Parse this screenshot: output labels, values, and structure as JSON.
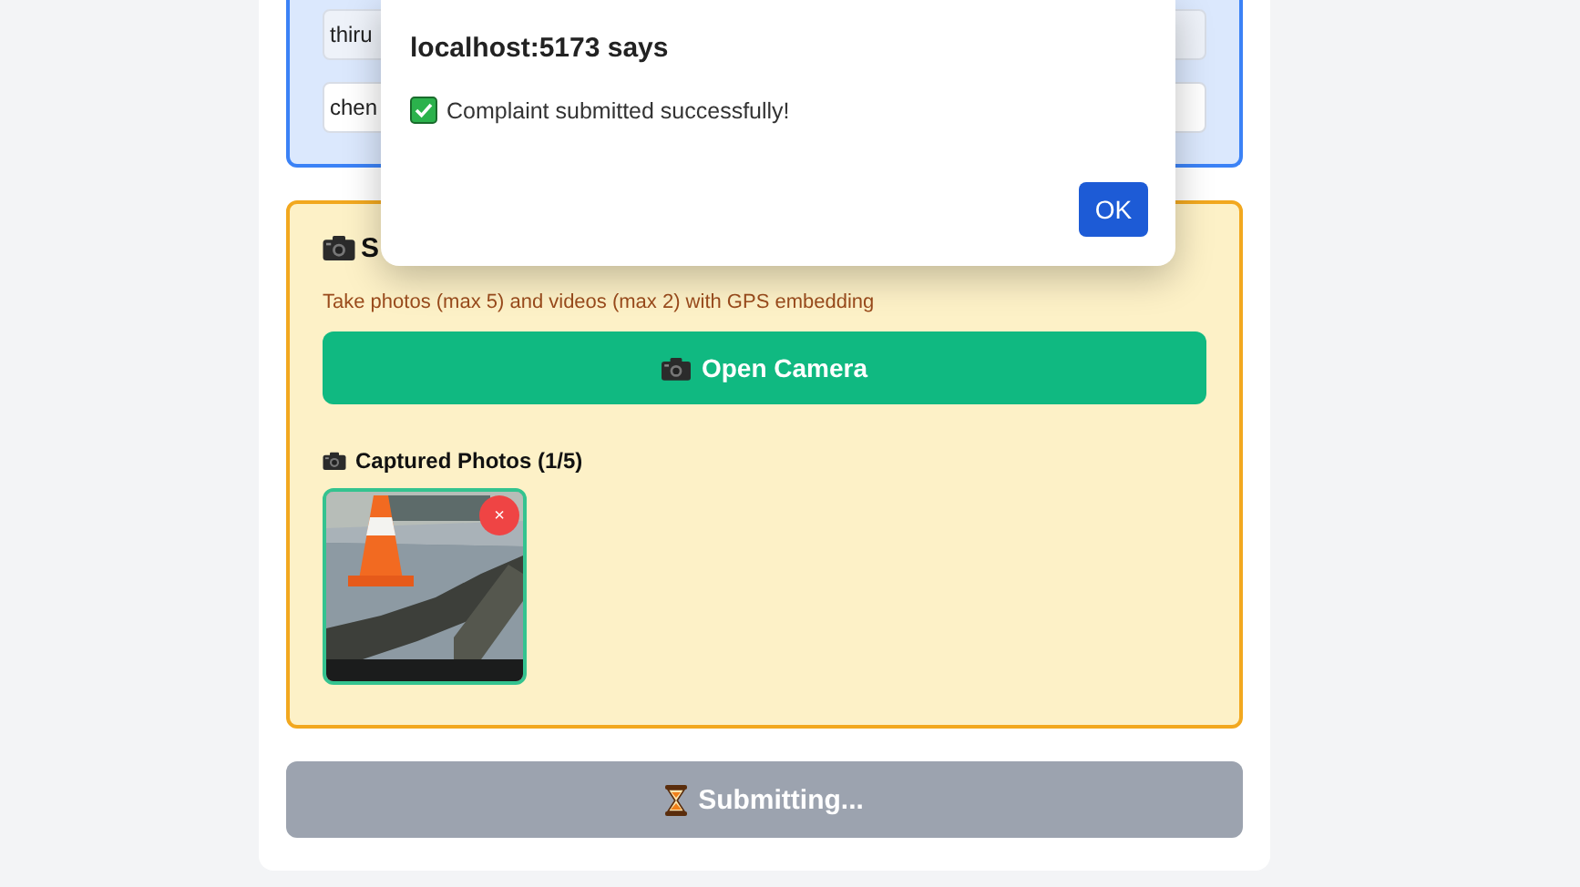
{
  "location_fields": [
    {
      "value": "thiru",
      "readonly": true
    },
    {
      "value": "chen",
      "readonly": false
    }
  ],
  "media_section": {
    "heading": "S",
    "hint": "Take photos (max 5) and videos (max 2) with GPS embedding",
    "open_camera_button": "Open Camera",
    "captured_label": "Captured Photos (1/5)",
    "photos": [
      {
        "kind": "picture",
        "remove": "×"
      }
    ]
  },
  "submit_button": {
    "label": "Submitting...",
    "disabled": true
  },
  "dialog": {
    "title": "localhost:5173 says",
    "message": "Complaint submitted successfully!",
    "ok_button": "OK"
  }
}
